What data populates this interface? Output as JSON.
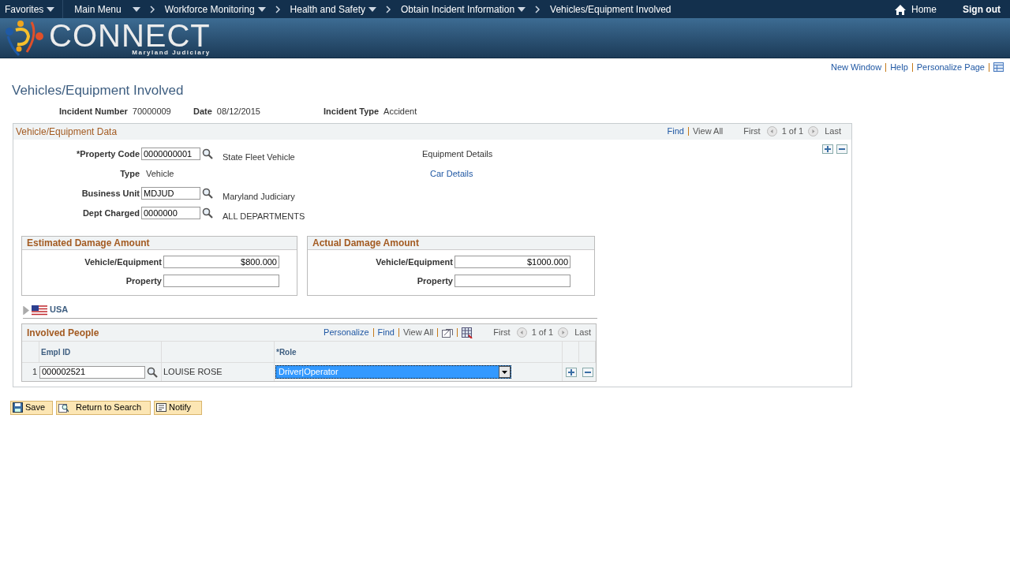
{
  "nav": {
    "items": [
      {
        "label": "Favorites",
        "menu": true,
        "chevron": false
      },
      {
        "label": "Main Menu",
        "menu": true,
        "chevron": false
      },
      {
        "label": "Workforce Monitoring",
        "menu": true,
        "chevron": true
      },
      {
        "label": "Health and Safety",
        "menu": true,
        "chevron": true
      },
      {
        "label": "Obtain Incident Information",
        "menu": true,
        "chevron": true
      },
      {
        "label": "Vehicles/Equipment Involved",
        "menu": false,
        "chevron": true
      }
    ],
    "home": "Home",
    "sign_out": "Sign out"
  },
  "banner": {
    "logo": "CONNECT",
    "subtitle": "Maryland Judiciary"
  },
  "page_links": [
    "New Window",
    "Help",
    "Personalize Page"
  ],
  "title": "Vehicles/Equipment Involved",
  "header_fields": [
    {
      "label": "Incident Number",
      "value": "70000009"
    },
    {
      "label": "Date",
      "value": "08/12/2015"
    },
    {
      "label": "Incident Type",
      "value": "Accident"
    }
  ],
  "vehicle_section": {
    "title": "Vehicle/Equipment Data",
    "find": "Find",
    "view_all": "View All",
    "first": "First",
    "count": "1 of 1",
    "last": "Last",
    "fields": [
      {
        "kind": "input",
        "label": "*Property Code",
        "value": "0000000001",
        "description": "State Fleet Vehicle",
        "side": "Equipment Details",
        "side_link": false
      },
      {
        "kind": "display",
        "label": "Type",
        "value": "Vehicle",
        "side": "Car Details",
        "side_link": true
      },
      {
        "kind": "input",
        "label": "Business Unit",
        "value": "MDJUD",
        "description": "Maryland Judiciary"
      },
      {
        "kind": "input",
        "label": "Dept Charged",
        "value": "0000000",
        "description": "ALL DEPARTMENTS"
      }
    ],
    "damage_groups": [
      {
        "title": "Estimated Damage Amount",
        "fields": [
          {
            "label": "Vehicle/Equipment",
            "value": "$800.000"
          },
          {
            "label": "Property"
          }
        ]
      },
      {
        "title": "Actual Damage Amount",
        "fields": [
          {
            "label": "Vehicle/Equipment",
            "value": "$1000.000"
          },
          {
            "label": "Property"
          }
        ]
      }
    ],
    "country": {
      "label": "USA",
      "expanded": false
    },
    "involved_people": {
      "title": "Involved People",
      "links": [
        "Personalize",
        "Find",
        "View All"
      ],
      "first": "First",
      "count": "1 of 1",
      "last": "Last",
      "columns": [
        "Empl ID",
        "*Role"
      ],
      "rows": [
        {
          "number": "1",
          "empl_id": "000002521",
          "name": "LOUISE ROSE",
          "role": "Driver|Operator",
          "focused": true
        }
      ]
    }
  },
  "buttons": [
    {
      "kind": "save",
      "label": "Save"
    },
    {
      "kind": "search",
      "label": "Return to Search"
    },
    {
      "kind": "notify",
      "label": "Notify"
    }
  ]
}
